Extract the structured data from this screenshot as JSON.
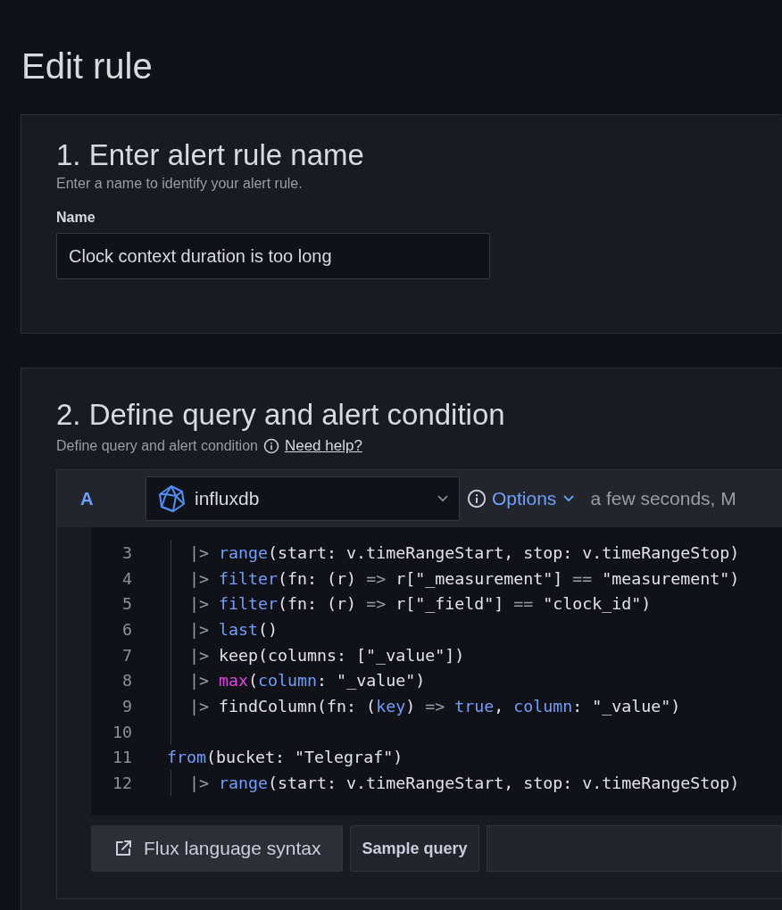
{
  "page_title": "Edit rule",
  "name_section": {
    "title": "1. Enter alert rule name",
    "description": "Enter a name to identify your alert rule.",
    "field_label": "Name",
    "field_value": "Clock context duration is too long"
  },
  "query_section": {
    "title": "2. Define query and alert condition",
    "description": "Define query and alert condition",
    "help_link": "Need help?",
    "query": {
      "ref": "A",
      "datasource": "influxdb",
      "options": "Options",
      "options_summary": "a few seconds, M",
      "code_lines": [
        {
          "number": "3",
          "indented": true,
          "tokens": [
            {
              "kind": "op",
              "text": "|>"
            },
            {
              "kind": "fn",
              "text": " range"
            },
            {
              "kind": "plain",
              "text": "(start: v.timeRangeStart, stop: v.timeRangeStop)"
            }
          ]
        },
        {
          "number": "4",
          "indented": true,
          "tokens": [
            {
              "kind": "op",
              "text": "|>"
            },
            {
              "kind": "fn",
              "text": " filter"
            },
            {
              "kind": "plain",
              "text": "(fn: (r) "
            },
            {
              "kind": "op",
              "text": "=>"
            },
            {
              "kind": "plain",
              "text": " r[\"_measurement\"] "
            },
            {
              "kind": "op",
              "text": "=="
            },
            {
              "kind": "plain",
              "text": " \"measurement\")"
            }
          ]
        },
        {
          "number": "5",
          "indented": true,
          "tokens": [
            {
              "kind": "op",
              "text": "|>"
            },
            {
              "kind": "fn",
              "text": " filter"
            },
            {
              "kind": "plain",
              "text": "(fn: (r) "
            },
            {
              "kind": "op",
              "text": "=>"
            },
            {
              "kind": "plain",
              "text": " r[\"_field\"] "
            },
            {
              "kind": "op",
              "text": "=="
            },
            {
              "kind": "plain",
              "text": " \"clock_id\")"
            }
          ]
        },
        {
          "number": "6",
          "indented": true,
          "tokens": [
            {
              "kind": "op",
              "text": "|>"
            },
            {
              "kind": "fn",
              "text": " last"
            },
            {
              "kind": "plain",
              "text": "()"
            }
          ]
        },
        {
          "number": "7",
          "indented": true,
          "tokens": [
            {
              "kind": "op",
              "text": "|>"
            },
            {
              "kind": "plain",
              "text": " keep(columns: [\"_value\"])"
            }
          ]
        },
        {
          "number": "8",
          "indented": true,
          "tokens": [
            {
              "kind": "op",
              "text": "|>"
            },
            {
              "kind": "builtin",
              "text": " max"
            },
            {
              "kind": "plain",
              "text": "("
            },
            {
              "kind": "fn",
              "text": "column"
            },
            {
              "kind": "plain",
              "text": ": \"_value\")"
            }
          ]
        },
        {
          "number": "9",
          "indented": true,
          "tokens": [
            {
              "kind": "op",
              "text": "|>"
            },
            {
              "kind": "plain",
              "text": " findColumn(fn: ("
            },
            {
              "kind": "fn",
              "text": "key"
            },
            {
              "kind": "plain",
              "text": ") "
            },
            {
              "kind": "op",
              "text": "=>"
            },
            {
              "kind": "fn",
              "text": " true"
            },
            {
              "kind": "plain",
              "text": ", "
            },
            {
              "kind": "fn",
              "text": "column"
            },
            {
              "kind": "plain",
              "text": ": \"_value\")"
            }
          ]
        },
        {
          "number": "10",
          "indented": true
        },
        {
          "number": "11",
          "indented": false,
          "tokens": [
            {
              "kind": "fn",
              "text": "from"
            },
            {
              "kind": "plain",
              "text": "(bucket: \"Telegraf\")"
            }
          ]
        },
        {
          "number": "12",
          "indented": true,
          "tokens": [
            {
              "kind": "op",
              "text": "|>"
            },
            {
              "kind": "fn",
              "text": " range"
            },
            {
              "kind": "plain",
              "text": "(start: v.timeRangeStart, stop: v.timeRangeStop)"
            }
          ]
        }
      ],
      "buttons": [
        "Flux language syntax",
        "Sample query"
      ]
    }
  }
}
